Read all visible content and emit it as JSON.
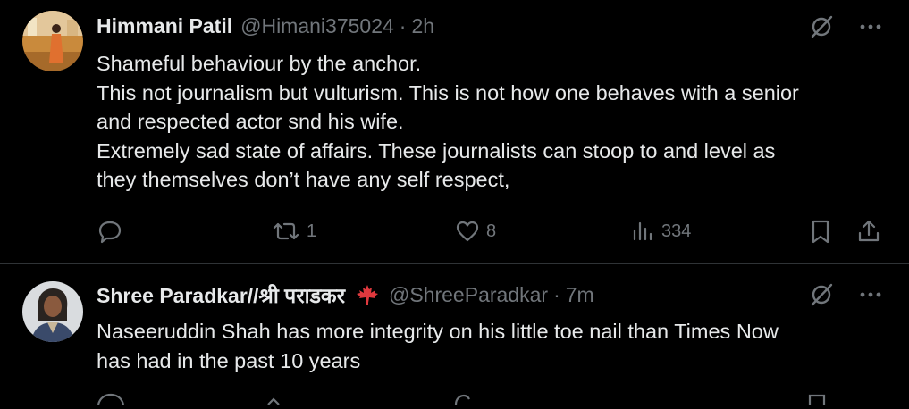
{
  "tweets": [
    {
      "author_name": "Himmani Patil",
      "handle": "@Himani375024",
      "separator": "·",
      "time": "2h",
      "lines": [
        "Shameful behaviour by the anchor.",
        "This not journalism but vulturism. This is not how one behaves with a senior",
        "and respected actor snd his wife.",
        "Extremely sad state of affairs. These journalists can stoop to and level as",
        "they themselves don’t have any self respect,"
      ],
      "replies": "",
      "reposts": "1",
      "likes": "8",
      "views": "334"
    },
    {
      "author_name": "Shree Paradkar//श्री पराडकर",
      "flag_icon": "maple-leaf-icon",
      "handle": "@ShreeParadkar",
      "separator": "·",
      "time": "7m",
      "lines": [
        "Naseeruddin Shah has more integrity on his little toe nail than Times Now",
        "has had in the past 10 years"
      ]
    }
  ],
  "colors": {
    "background": "#000000",
    "text": "#e7e9ea",
    "muted": "#71767b",
    "divider": "#2f3336",
    "flag_red": "#e0393e"
  },
  "icons": {
    "top": [
      "grok-slash-icon",
      "more-options-icon"
    ],
    "actions": [
      "reply-icon",
      "repost-icon",
      "like-icon",
      "views-icon",
      "bookmark-icon",
      "share-icon"
    ]
  }
}
